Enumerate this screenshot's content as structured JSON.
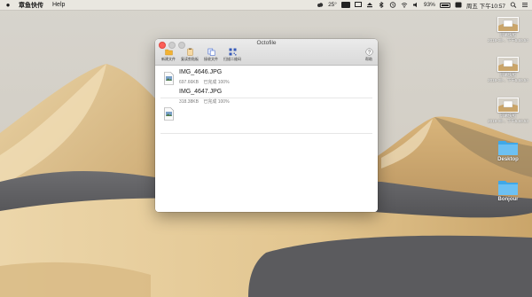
{
  "menubar": {
    "app_name": "章鱼快传",
    "items": [
      "Help"
    ],
    "temperature": "25°",
    "battery_percent": "93%",
    "datetime": "周五 下午10:57"
  },
  "window": {
    "title": "Octofile",
    "toolbar": {
      "new_file": "新建文件",
      "new_clip": "复读剪贴板",
      "receive": "接收文件",
      "scan_qr": "扫描二维码",
      "help": "帮助"
    },
    "files": [
      {
        "name": "IMG_4646.JPG",
        "size": "697.66KB",
        "status": "已完成 100%"
      },
      {
        "name": "IMG_4647.JPG",
        "size": "318.38KB",
        "status": "已完成 100%"
      }
    ]
  },
  "desktop": {
    "screenshots": [
      {
        "label1": "屏幕快照",
        "label2": "2019-08-.. 下午5.59.54"
      },
      {
        "label1": "屏幕快照",
        "label2": "2019-08-.. 下午5.59.54"
      },
      {
        "label1": "屏幕快照",
        "label2": "2019-08-.. 下午5.59.53"
      }
    ],
    "folders": [
      {
        "label": "Desktop"
      },
      {
        "label": "Bonjour"
      }
    ]
  },
  "colors": {
    "sky": "#c9c6c0",
    "sand_light": "#e8cf9f",
    "sand_dark": "#a98a58",
    "shadow": "#5a5a5c",
    "folder_blue": "#3fa8e8"
  }
}
